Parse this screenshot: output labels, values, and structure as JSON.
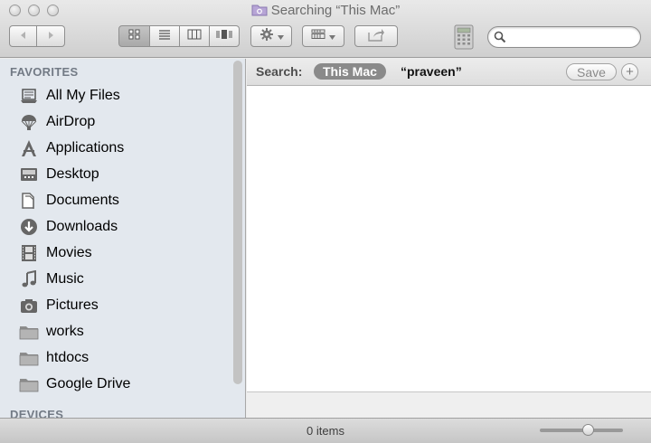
{
  "window": {
    "title": "Searching “This Mac”",
    "title_icon": "smart-folder-icon"
  },
  "toolbar": {
    "nav": [
      "back-icon",
      "forward-icon"
    ],
    "view_modes": [
      {
        "name": "icon-view",
        "icon": "grid-icon",
        "active": true
      },
      {
        "name": "list-view",
        "icon": "list-icon",
        "active": false
      },
      {
        "name": "column-view",
        "icon": "columns-icon",
        "active": false
      },
      {
        "name": "coverflow-view",
        "icon": "coverflow-icon",
        "active": false
      }
    ],
    "action_icon": "gear-icon",
    "arrange_icon": "arrange-icon",
    "share_icon": "share-icon",
    "calculator_icon": "calculator-icon",
    "search_value": "",
    "search_icon": "magnifier-icon"
  },
  "sidebar": {
    "favorites_header": "FAVORITES",
    "devices_header": "DEVICES",
    "items": [
      {
        "label": "All My Files",
        "icon": "all-files-icon"
      },
      {
        "label": "AirDrop",
        "icon": "airdrop-icon"
      },
      {
        "label": "Applications",
        "icon": "applications-icon"
      },
      {
        "label": "Desktop",
        "icon": "desktop-icon"
      },
      {
        "label": "Documents",
        "icon": "documents-icon"
      },
      {
        "label": "Downloads",
        "icon": "downloads-icon"
      },
      {
        "label": "Movies",
        "icon": "movies-icon"
      },
      {
        "label": "Music",
        "icon": "music-icon"
      },
      {
        "label": "Pictures",
        "icon": "pictures-icon"
      },
      {
        "label": "works",
        "icon": "folder-icon"
      },
      {
        "label": "htdocs",
        "icon": "folder-icon"
      },
      {
        "label": "Google Drive",
        "icon": "folder-icon"
      }
    ]
  },
  "search_bar": {
    "label": "Search:",
    "scope_active": "This Mac",
    "query": "“praveen”",
    "save_label": "Save",
    "add_label": "+"
  },
  "status": {
    "items_text": "0 items",
    "icon_size_fraction": 0.6
  },
  "colors": {
    "sidebar_bg": "#e3e8ee",
    "scope_pill": "#8a8a8a"
  }
}
